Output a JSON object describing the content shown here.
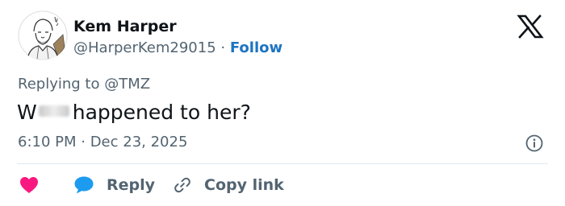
{
  "author": {
    "display_name": "Kem Harper",
    "handle": "@HarperKem29015",
    "separator": "·",
    "follow_label": "Follow"
  },
  "reply_context": {
    "text": "Replying to @TMZ"
  },
  "tweet": {
    "text_start": "W",
    "text_end": "happened to her?"
  },
  "meta": {
    "timestamp": "6:10 PM · Dec 23, 2025"
  },
  "actions": {
    "reply_label": "Reply",
    "copy_link_label": "Copy link"
  },
  "icons": {
    "like": "heart-icon",
    "reply": "speech-bubble-icon",
    "copy_link": "link-icon",
    "info": "info-icon",
    "brand": "x-logo-icon"
  },
  "colors": {
    "heart": "#f91880",
    "reply_bubble": "#1d9bf0",
    "follow": "#1d74c2",
    "secondary_text": "#536471"
  }
}
